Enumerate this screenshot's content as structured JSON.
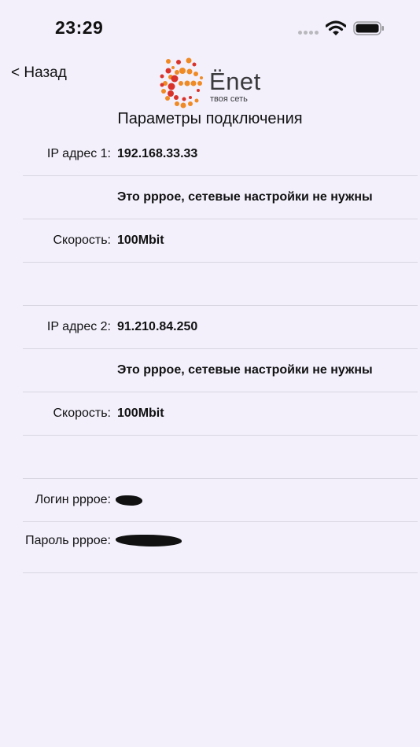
{
  "status_bar": {
    "time": "23:29",
    "icons": [
      "signal-dots-icon",
      "wifi-icon",
      "battery-icon"
    ]
  },
  "nav": {
    "back_label": "< Назад"
  },
  "logo": {
    "name": "Ёnet",
    "tagline": "твоя сеть"
  },
  "page_title": "Параметры подключения",
  "connection_1": {
    "ip_label": "IP адрес 1:",
    "ip_value": "192.168.33.33",
    "note": "Это pppoe, сетевые настройки не нужны",
    "speed_label": "Скорость:",
    "speed_value": "100Mbit"
  },
  "connection_2": {
    "ip_label": "IP адрес 2:",
    "ip_value": "91.210.84.250",
    "note": "Это pppoe, сетевые настройки не нужны",
    "speed_label": "Скорость:",
    "speed_value": "100Mbit"
  },
  "pppoe": {
    "login_label": "Логин pppoe:",
    "password_label": "Пароль pppoe:"
  },
  "colors": {
    "background": "#f3f0fc",
    "divider": "#d8d6e0",
    "logo_orange": "#f08a24",
    "logo_red": "#d9322b"
  }
}
